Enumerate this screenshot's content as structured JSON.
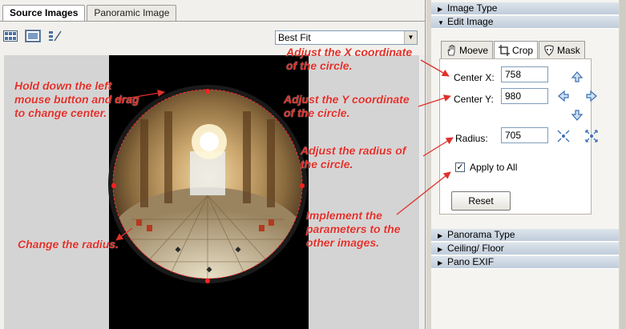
{
  "tabs": [
    {
      "label": "Source Images",
      "active": true
    },
    {
      "label": "Panoramic Image",
      "active": false
    }
  ],
  "toolbar": {
    "icons": [
      "thumbnail-grid-icon",
      "single-image-icon",
      "arrange-icon"
    ]
  },
  "fit_select": {
    "value": "Best Fit"
  },
  "annotations": {
    "drag_center": [
      "Hold down the left",
      "mouse button and drag",
      "to change center."
    ],
    "change_radius": "Change the radius.",
    "adjust_x": [
      "Adjust the X coordinate",
      "of the circle."
    ],
    "adjust_y": [
      "Adjust the Y coordinate",
      "of the circle."
    ],
    "adjust_radius": [
      "Adjust the radius of",
      "the circle."
    ],
    "implement": [
      "Implement the",
      "parameters to the",
      "other images."
    ]
  },
  "accordion": {
    "image_type": "Image Type",
    "edit_image": "Edit Image",
    "panorama_type": "Panorama Type",
    "ceiling_floor": "Ceiling/ Floor",
    "pano_exif": "Pano EXIF"
  },
  "edit_tabs": [
    {
      "label": "Moeve",
      "icon": "hand-icon",
      "active": false
    },
    {
      "label": "Crop",
      "icon": "crop-icon",
      "active": true
    },
    {
      "label": "Mask",
      "icon": "mask-icon",
      "active": false
    }
  ],
  "crop": {
    "center_x_label": "Center X:",
    "center_x_value": "758",
    "center_y_label": "Center Y:",
    "center_y_value": "980",
    "radius_label": "Radius:",
    "radius_value": "705",
    "apply_all_label": "Apply to All",
    "apply_all_checked": true,
    "reset_label": "Reset"
  },
  "colors": {
    "annotation": "#e0302a",
    "arrow_blue": "#3a6fb0"
  }
}
